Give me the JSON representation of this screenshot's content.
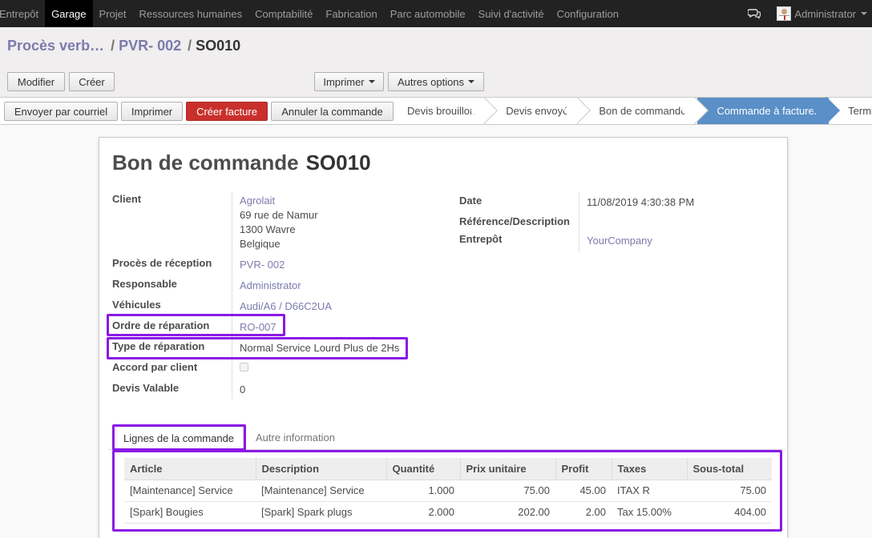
{
  "topbar": {
    "menu": [
      "Entrepôt",
      "Garage",
      "Projet",
      "Ressources humaines",
      "Comptabilité",
      "Fabrication",
      "Parc automobile",
      "Suivi d'activité",
      "Configuration"
    ],
    "active_index": 1,
    "user": "Administrator"
  },
  "breadcrumb": {
    "first": "Procès verb…",
    "second": "PVR- 002",
    "current": "SO010",
    "sep": "/"
  },
  "toolbar": {
    "edit": "Modifier",
    "create": "Créer",
    "print": "Imprimer",
    "more": "Autres options"
  },
  "statusbar": {
    "buttons": [
      "Envoyer par courriel",
      "Imprimer",
      "Créer facture",
      "Annuler la commande"
    ],
    "steps": [
      "Devis brouillon",
      "Devis envoyé",
      "Bon de commande",
      "Commande à facturer",
      "Terminée"
    ],
    "current_step": "Commande à facturer"
  },
  "doc": {
    "title_label": "Bon de commande",
    "title_number": "SO010"
  },
  "fields_left": {
    "client_label": "Client",
    "client_name": "Agrolait",
    "client_addr1": "69 rue de Namur",
    "client_addr2": "1300 Wavre",
    "client_addr3": "Belgique",
    "reception_label": "Procès de réception",
    "reception_value": "PVR- 002",
    "responsable_label": "Responsable",
    "responsable_value": "Administrator",
    "vehicule_label": "Véhicules",
    "vehicule_value": "Audi/A6 / D66C2UA",
    "ordre_label": "Ordre de réparation",
    "ordre_value": "RO-007",
    "type_label": "Type de réparation",
    "type_value": "Normal Service Lourd Plus de 2Hs",
    "accord_label": "Accord par client",
    "accord_checked": false,
    "devis_label": "Devis Valable",
    "devis_value": "0"
  },
  "fields_right": {
    "date_label": "Date",
    "date_value": "11/08/2019 4:30:38 PM",
    "ref_label": "Référence/Description",
    "ref_value": "",
    "entrepot_label": "Entrepôt",
    "entrepot_value": "YourCompany"
  },
  "tabs": [
    "Lignes de la commande",
    "Autre information"
  ],
  "lines": {
    "columns": [
      "Article",
      "Description",
      "Quantité",
      "Prix unitaire",
      "Profit",
      "Taxes",
      "Sous-total"
    ],
    "rows": [
      [
        "[Maintenance] Service",
        "[Maintenance] Service",
        "1.000",
        "75.00",
        "45.00",
        "ITAX R",
        "75.00"
      ],
      [
        "[Spark] Bougies",
        "[Spark] Spark plugs",
        "2.000",
        "202.00",
        "2.00",
        "Tax 15.00%",
        "404.00"
      ]
    ]
  },
  "colors": {
    "highlight": "#8a19e6",
    "link": "#7c7bad",
    "current_step": "#5a8fc7",
    "primary_button": "#c9302c"
  }
}
